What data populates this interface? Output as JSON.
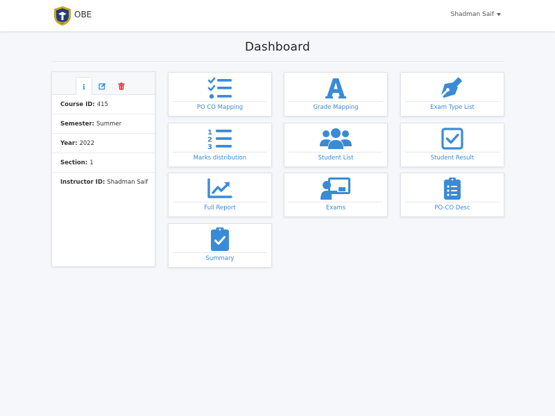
{
  "navbar": {
    "brand": "OBE",
    "user_name": "Shadman Saif"
  },
  "page": {
    "title": "Dashboard"
  },
  "course_info": {
    "tabs": [
      {
        "icon": "info-icon",
        "color": "#3a8bd6"
      },
      {
        "icon": "edit-icon",
        "color": "#3a8bd6"
      },
      {
        "icon": "trash-icon",
        "color": "#e0303a"
      }
    ],
    "fields": [
      {
        "label": "Course ID:",
        "value": "415"
      },
      {
        "label": "Semester:",
        "value": "Summer"
      },
      {
        "label": "Year:",
        "value": "2022"
      },
      {
        "label": "Section:",
        "value": "1"
      },
      {
        "label": "Instructor ID:",
        "value": "Shadman Saif"
      }
    ]
  },
  "tiles": [
    {
      "label": "PO CO Mapping",
      "icon": "list-check-icon"
    },
    {
      "label": "Grade Mapping",
      "icon": "letter-a-icon"
    },
    {
      "label": "Exam Type List",
      "icon": "pen-nib-icon"
    },
    {
      "label": "Marks distribution",
      "icon": "numbered-list-icon"
    },
    {
      "label": "Student List",
      "icon": "users-icon"
    },
    {
      "label": "Student Result",
      "icon": "checkbox-icon"
    },
    {
      "label": "Full Report",
      "icon": "chart-line-icon"
    },
    {
      "label": "Exams",
      "icon": "teacher-board-icon"
    },
    {
      "label": "PO-CO Desc",
      "icon": "clipboard-list-icon"
    },
    {
      "label": "Summary",
      "icon": "clipboard-check-icon"
    }
  ],
  "colors": {
    "accent": "#3a8bd6",
    "danger": "#e0303a",
    "logo_gold": "#c9a227",
    "logo_blue": "#1f3d7a"
  }
}
